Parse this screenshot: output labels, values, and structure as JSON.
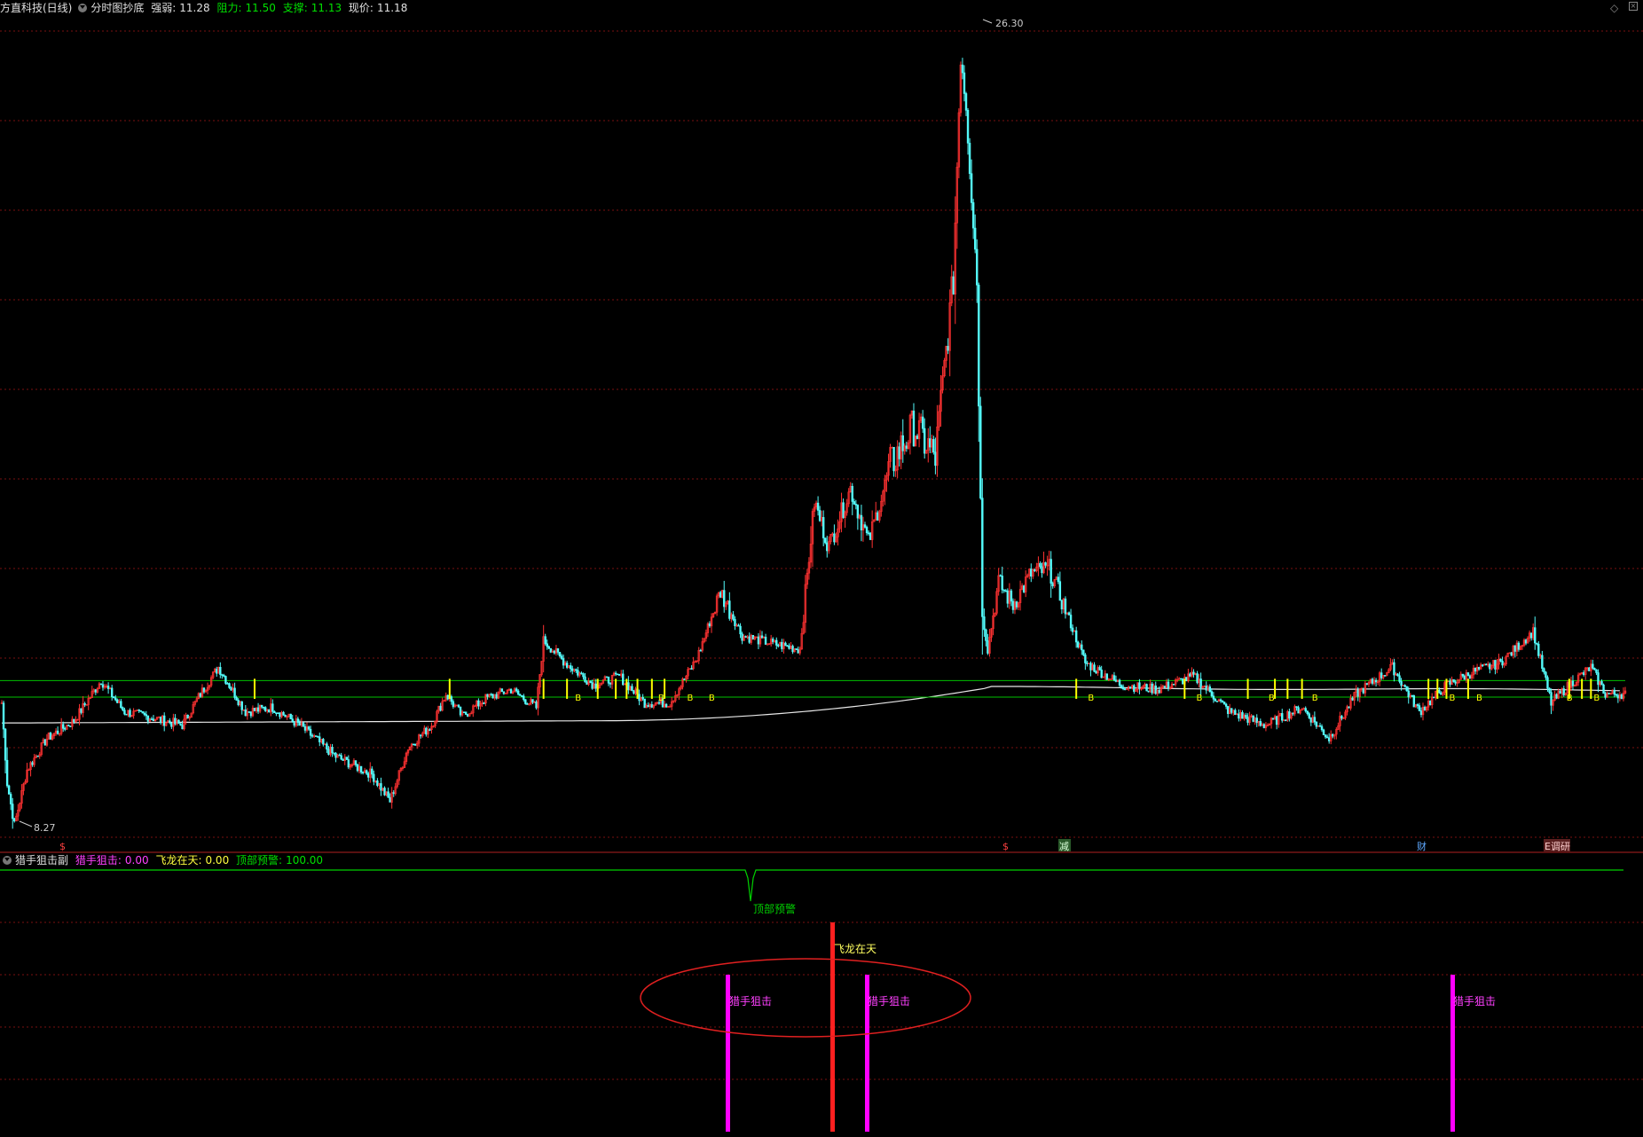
{
  "header": {
    "title": "方直科技(日线)",
    "indicator_name": "分时图抄底",
    "strength_label": "强弱:",
    "strength_value": "11.28",
    "resistance_label": "阻力:",
    "resistance_value": "11.50",
    "support_label": "支撑:",
    "support_value": "11.13",
    "price_label": "现价:",
    "price_value": "11.18"
  },
  "main_panel": {
    "high_label": "26.30",
    "low_label": "8.27",
    "event_markers": [
      "$",
      "$",
      "减",
      "财",
      "E调研"
    ]
  },
  "sub_header": {
    "name": "猎手狙击副",
    "s1_label": "猎手狙击:",
    "s1_value": "0.00",
    "s2_label": "飞龙在天:",
    "s2_value": "0.00",
    "s3_label": "顶部预警:",
    "s3_value": "100.00"
  },
  "sub_panel": {
    "label_top_warning": "顶部预警",
    "label_flying_dragon": "飞龙在天",
    "label_hunter_1": "猎手狙击",
    "label_hunter_2": "猎手狙击",
    "label_hunter_3": "猎手狙击"
  },
  "colors": {
    "background": "#000000",
    "up": "#ff3232",
    "down": "#54fcfc",
    "ma": "#e8e8e8",
    "hline": "#00c000",
    "grid": "#7a1010",
    "signal_b": "#ffff00",
    "hunter": "#ff00ff",
    "dragon": "#ff2020",
    "warning": "#00d000"
  },
  "chart_data": [
    {
      "type": "candlestick",
      "title": "方直科技(日线)",
      "price_range": [
        8.27,
        26.3
      ],
      "high": 26.3,
      "low": 8.27,
      "anchors": [
        [
          0,
          11.0
        ],
        [
          3,
          9.2
        ],
        [
          7,
          8.27
        ],
        [
          14,
          9.5
        ],
        [
          25,
          10.2
        ],
        [
          40,
          10.6
        ],
        [
          55,
          11.5
        ],
        [
          68,
          10.8
        ],
        [
          80,
          10.7
        ],
        [
          100,
          10.5
        ],
        [
          110,
          11.2
        ],
        [
          120,
          11.8
        ],
        [
          135,
          10.8
        ],
        [
          150,
          10.9
        ],
        [
          165,
          10.5
        ],
        [
          185,
          9.8
        ],
        [
          205,
          9.4
        ],
        [
          215,
          8.8
        ],
        [
          225,
          10.0
        ],
        [
          238,
          10.5
        ],
        [
          246,
          11.2
        ],
        [
          255,
          10.7
        ],
        [
          268,
          11.1
        ],
        [
          282,
          11.3
        ],
        [
          296,
          10.9
        ],
        [
          300,
          12.4
        ],
        [
          312,
          11.9
        ],
        [
          328,
          11.4
        ],
        [
          342,
          11.6
        ],
        [
          356,
          11.0
        ],
        [
          370,
          11.0
        ],
        [
          385,
          12.0
        ],
        [
          398,
          13.5
        ],
        [
          410,
          12.5
        ],
        [
          430,
          12.3
        ],
        [
          442,
          12.2
        ],
        [
          450,
          15.5
        ],
        [
          458,
          14.5
        ],
        [
          470,
          15.8
        ],
        [
          480,
          14.6
        ],
        [
          492,
          16.3
        ],
        [
          505,
          17.2
        ],
        [
          517,
          16.5
        ],
        [
          527,
          20.5
        ],
        [
          531,
          25.6
        ],
        [
          534,
          24.5
        ],
        [
          540,
          20.5
        ],
        [
          543,
          13.0
        ],
        [
          546,
          12.2
        ],
        [
          552,
          13.7
        ],
        [
          560,
          13.2
        ],
        [
          570,
          13.9
        ],
        [
          580,
          14.0
        ],
        [
          588,
          13.2
        ],
        [
          600,
          11.9
        ],
        [
          620,
          11.4
        ],
        [
          640,
          11.3
        ],
        [
          660,
          11.6
        ],
        [
          680,
          10.8
        ],
        [
          700,
          10.5
        ],
        [
          720,
          10.9
        ],
        [
          735,
          10.2
        ],
        [
          750,
          11.2
        ],
        [
          770,
          11.8
        ],
        [
          785,
          10.8
        ],
        [
          800,
          11.4
        ],
        [
          815,
          11.7
        ],
        [
          830,
          11.9
        ],
        [
          848,
          12.6
        ],
        [
          858,
          11.0
        ],
        [
          868,
          11.4
        ],
        [
          880,
          11.8
        ],
        [
          888,
          11.2
        ]
      ],
      "ma_line": "slowly rising moving average from ~10.5 to ~11.3",
      "support_lines": [
        11.5,
        11.13
      ],
      "signal": "B"
    },
    {
      "type": "bar",
      "title": "猎手狙击副",
      "series": [
        {
          "name": "猎手狙击",
          "positions": [
            395,
            470,
            787
          ],
          "value": 100
        },
        {
          "name": "飞龙在天",
          "positions": [
            452
          ],
          "value": 100
        },
        {
          "name": "顶部预警",
          "dip_at": 407,
          "baseline": 100
        }
      ]
    }
  ]
}
